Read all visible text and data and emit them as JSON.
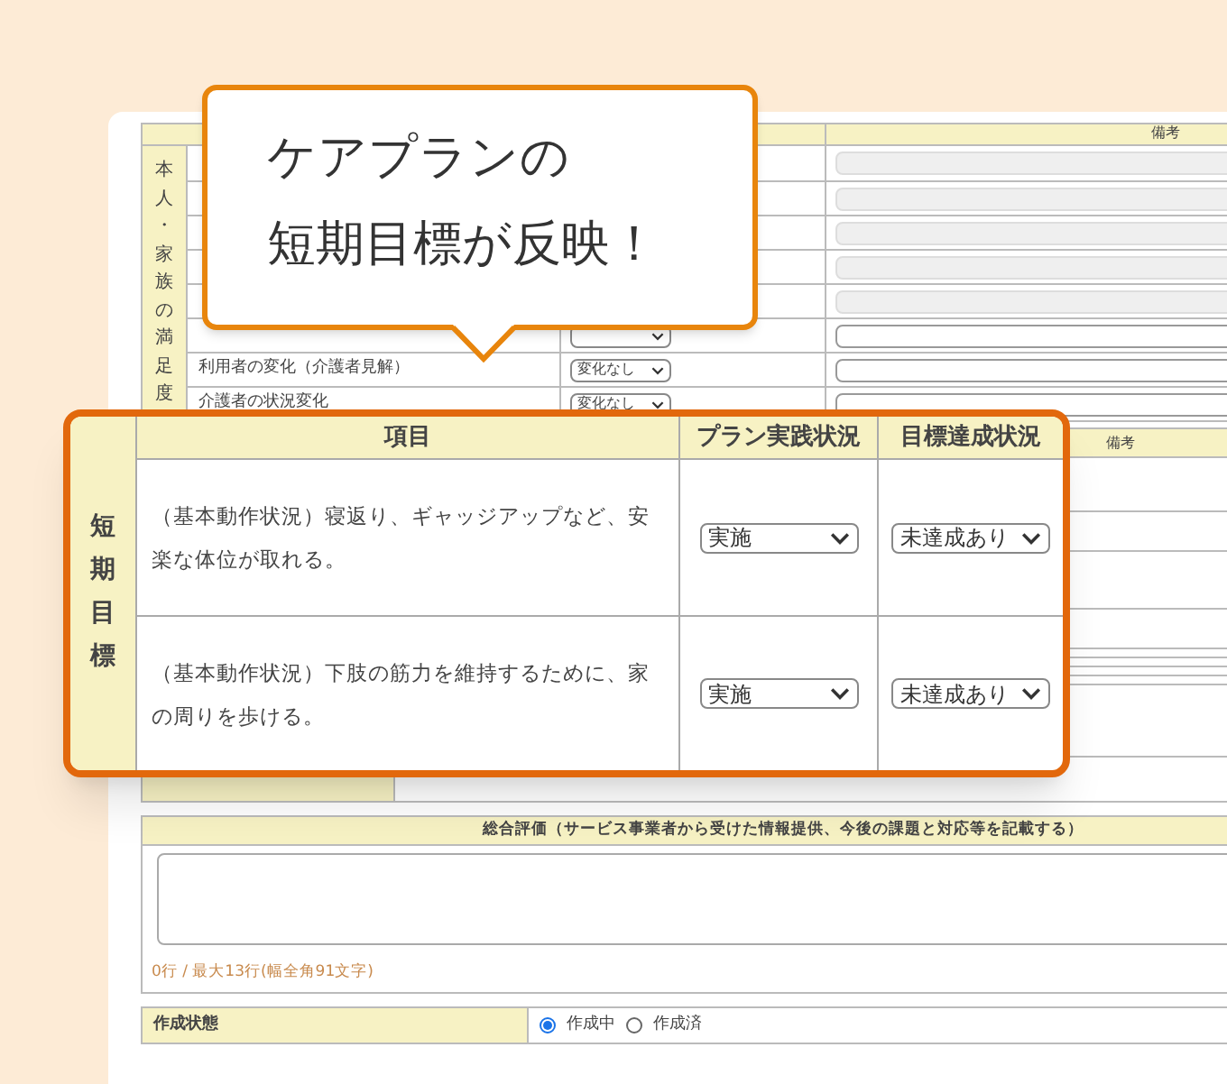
{
  "callout": {
    "lines": [
      "ケアプランの",
      "短期目標が反映！"
    ]
  },
  "satisfaction": {
    "side_label": "本人・家族の満足度",
    "remarks_header": "備考",
    "rows": [
      {
        "disabled": true
      },
      {
        "disabled": true
      },
      {
        "disabled": true
      },
      {
        "disabled": true
      },
      {
        "disabled": true
      },
      {
        "disabled": false
      },
      {
        "disabled": false,
        "label": "利用者の変化（介護者見解）",
        "select": "変化なし"
      },
      {
        "disabled": false,
        "label": "介護者の状況変化",
        "select": "変化なし"
      }
    ]
  },
  "background_section": {
    "remarks_header": "備考"
  },
  "short_term_goals": {
    "side_label": "短期目標",
    "columns": [
      "項目",
      "プラン実践状況",
      "目標達成状況"
    ],
    "rows": [
      {
        "item": "（基本動作状況）寝返り、ギャッジアップなど、安楽な体位が取れる。",
        "practice": "実施",
        "achievement": "未達成あり"
      },
      {
        "item": "（基本動作状況）下肢の筋力を維持するために、家の周りを歩ける。",
        "practice": "実施",
        "achievement": "未達成あり"
      }
    ]
  },
  "overall_evaluation": {
    "title": "総合評価（サービス事業者から受けた情報提供、今後の課題と対応等を記載する）",
    "counter": "0行 / 最大13行(幅全角91文字)"
  },
  "creation_status": {
    "label": "作成状態",
    "options": [
      {
        "label": "作成中",
        "selected": true
      },
      {
        "label": "作成済",
        "selected": false
      }
    ]
  }
}
